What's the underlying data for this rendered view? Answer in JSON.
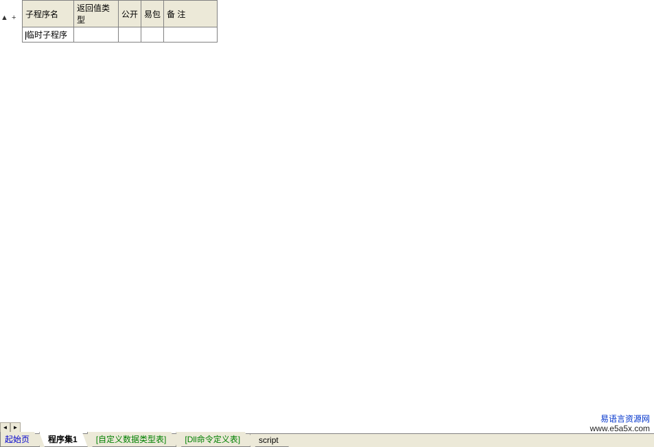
{
  "table": {
    "headers": {
      "name": "子程序名",
      "return_type": "返回值类型",
      "public": "公开",
      "package": "易包",
      "remark": "备 注"
    },
    "rows": [
      {
        "name": "临时子程序",
        "return_type": "",
        "public": "",
        "package": "",
        "remark": ""
      }
    ]
  },
  "gutter": {
    "mark1": "▲",
    "mark2": "+"
  },
  "scrollbar": {
    "left_arrow": "◄",
    "right_arrow": "►"
  },
  "tabs": [
    {
      "label": "起始页",
      "class": "start",
      "active": false
    },
    {
      "label": "程序集1",
      "class": "normal",
      "active": true
    },
    {
      "label": "[自定义数据类型表]",
      "class": "green",
      "active": false
    },
    {
      "label": "[Dll命令定义表]",
      "class": "green",
      "active": false
    },
    {
      "label": "script",
      "class": "normal",
      "active": false
    }
  ],
  "watermark": {
    "title": "易语言资源网",
    "url": "www.e5a5x.com"
  }
}
